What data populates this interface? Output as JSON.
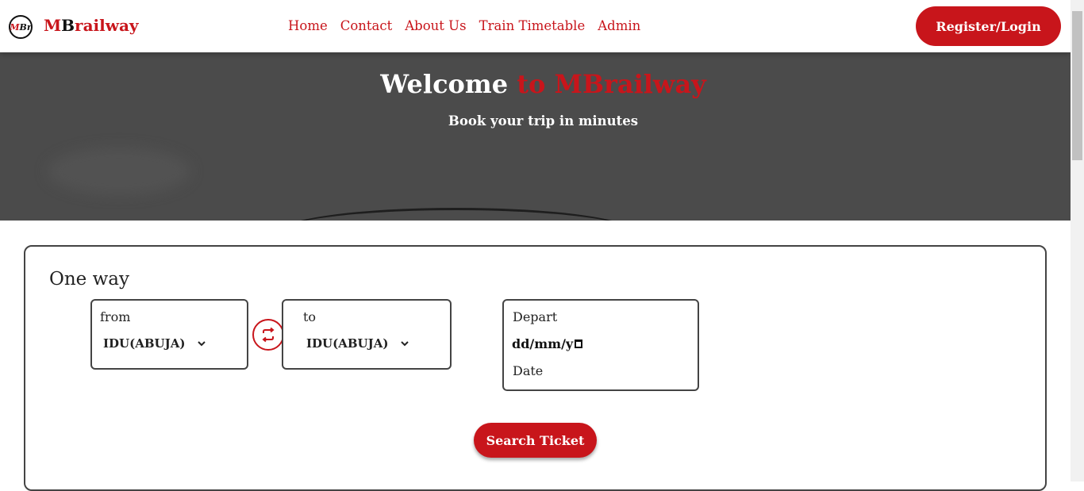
{
  "brand": {
    "logo_text_m": "M",
    "logo_text_b": "Br",
    "name_prefix": "M",
    "name_b": "B",
    "name_rest": "railway"
  },
  "nav": {
    "links": [
      "Home",
      "Contact",
      "About Us",
      "Train Timetable",
      "Admin"
    ],
    "register_label": "Register/Login"
  },
  "hero": {
    "title_white": "Welcome",
    "title_red": "to MBrailway",
    "subtitle": "Book your trip in minutes"
  },
  "booking": {
    "trip_type": "One way",
    "from_label": "from",
    "from_value": "IDU(ABUJA)",
    "to_label": "to",
    "to_value": "IDU(ABUJA)",
    "depart_label": "Depart",
    "date_placeholder": "dd/mm/y",
    "date_label": "Date",
    "search_label": "Search Ticket"
  },
  "colors": {
    "accent": "#c8151b",
    "hero_bg": "#4b4b4b"
  },
  "icons": [
    "swap-arrows-icon",
    "chevron-down-icon",
    "calendar-icon"
  ]
}
